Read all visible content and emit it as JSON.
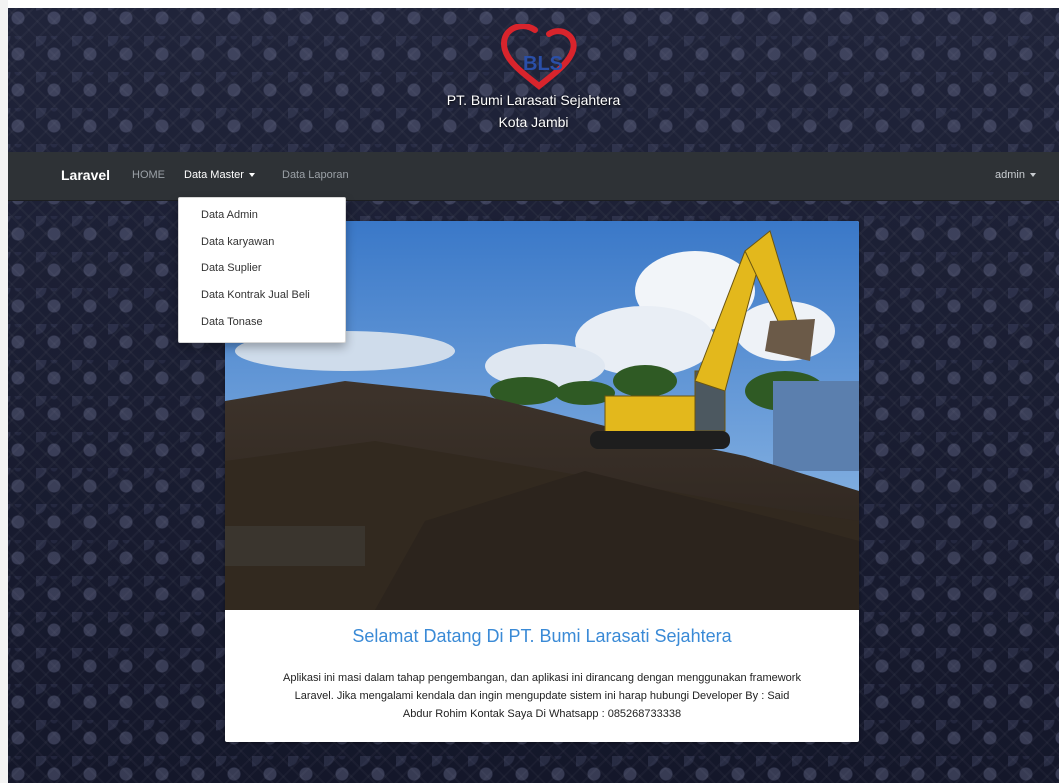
{
  "header": {
    "logo_text": "BLS",
    "company_name": "PT. Bumi Larasati Sejahtera",
    "city": "Kota Jambi"
  },
  "navbar": {
    "brand": "Laravel",
    "items": [
      {
        "label": "HOME"
      },
      {
        "label": "Data Master"
      },
      {
        "label": "Data Laporan"
      }
    ],
    "user": "admin"
  },
  "dropdown": {
    "items": [
      {
        "label": "Data Admin"
      },
      {
        "label": "Data karyawan"
      },
      {
        "label": "Data Suplier"
      },
      {
        "label": "Data Kontrak Jual Beli"
      },
      {
        "label": "Data Tonase"
      }
    ]
  },
  "main": {
    "welcome": "Selamat Datang Di PT. Bumi Larasati Sejahtera",
    "description_lines": [
      "Aplikasi ini masi dalam tahap pengembangan, dan aplikasi ini dirancang dengan menggunakan framework",
      "Laravel. Jika mengalami kendala dan ingin mengupdate sistem ini harap hubungi Developer By : Said",
      "Abdur Rohim Kontak Saya Di Whatsapp : 085268733338"
    ]
  },
  "colors": {
    "accent": "#3a8ad6",
    "navbar": "#2e3236",
    "logo_red": "#d8242c",
    "logo_blue": "#2a4fa8"
  }
}
